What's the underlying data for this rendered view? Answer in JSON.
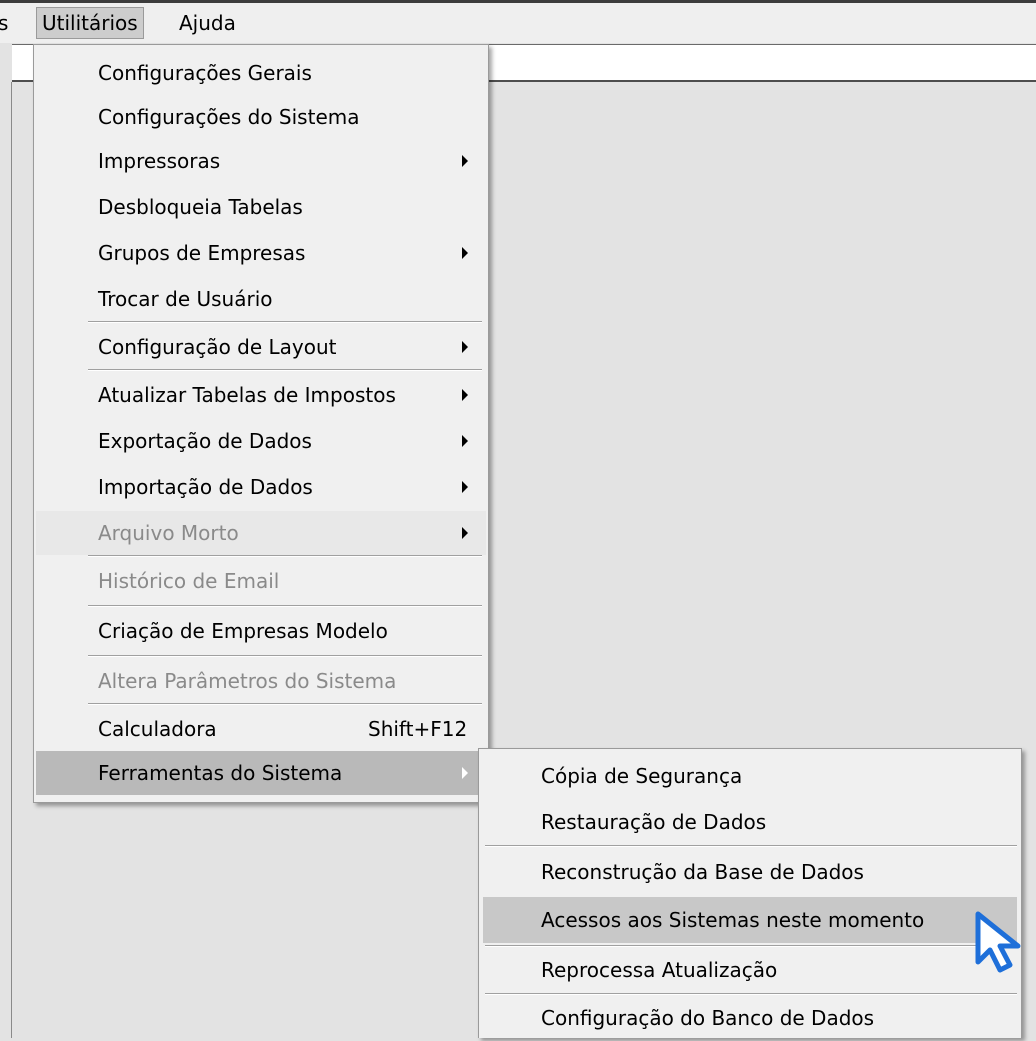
{
  "menubar": {
    "prev_fragment": "s",
    "utilitarios": "Utilitários",
    "ajuda": "Ajuda"
  },
  "main_menu": {
    "items": [
      {
        "label": "Configurações Gerais",
        "submenu": false,
        "enabled": true
      },
      {
        "label": "Configurações do Sistema",
        "submenu": false,
        "enabled": true
      },
      {
        "label": "Impressoras",
        "submenu": true,
        "enabled": true
      },
      {
        "label": "Desbloqueia Tabelas",
        "submenu": false,
        "enabled": true
      },
      {
        "label": "Grupos de Empresas",
        "submenu": true,
        "enabled": true
      },
      {
        "label": "Trocar de Usuário",
        "submenu": false,
        "enabled": true
      },
      {
        "label": "Configuração de Layout",
        "submenu": true,
        "enabled": true
      },
      {
        "label": "Atualizar Tabelas de Impostos",
        "submenu": true,
        "enabled": true
      },
      {
        "label": "Exportação de Dados",
        "submenu": true,
        "enabled": true
      },
      {
        "label": "Importação de Dados",
        "submenu": true,
        "enabled": true
      },
      {
        "label": "Arquivo Morto",
        "submenu": true,
        "enabled": false
      },
      {
        "label": "Histórico de Email",
        "submenu": false,
        "enabled": false
      },
      {
        "label": "Criação de Empresas Modelo",
        "submenu": false,
        "enabled": true
      },
      {
        "label": "Altera Parâmetros do Sistema",
        "submenu": false,
        "enabled": false
      },
      {
        "label": "Calculadora",
        "shortcut": "Shift+F12",
        "submenu": false,
        "enabled": true
      },
      {
        "label": "Ferramentas do Sistema",
        "submenu": true,
        "enabled": true,
        "selected": true
      }
    ]
  },
  "sub_menu": {
    "items": [
      {
        "label": "Cópia de Segurança"
      },
      {
        "label": "Restauração de Dados"
      },
      {
        "label": "Reconstrução da Base de Dados"
      },
      {
        "label": "Acessos aos Sistemas neste momento",
        "highlighted": true
      },
      {
        "label": "Reprocessa Atualização"
      },
      {
        "label": "Configuração do Banco de Dados"
      }
    ]
  },
  "colors": {
    "background": "#e3e3e3",
    "menu_bg": "#f0f0f0",
    "highlight": "#c8c8c8",
    "disabled_text": "#8a8a8a",
    "cursor_outline": "#1e6fd9"
  },
  "icons": {
    "submenu_arrow": "triangle-right-icon",
    "cursor": "mouse-pointer-icon"
  }
}
